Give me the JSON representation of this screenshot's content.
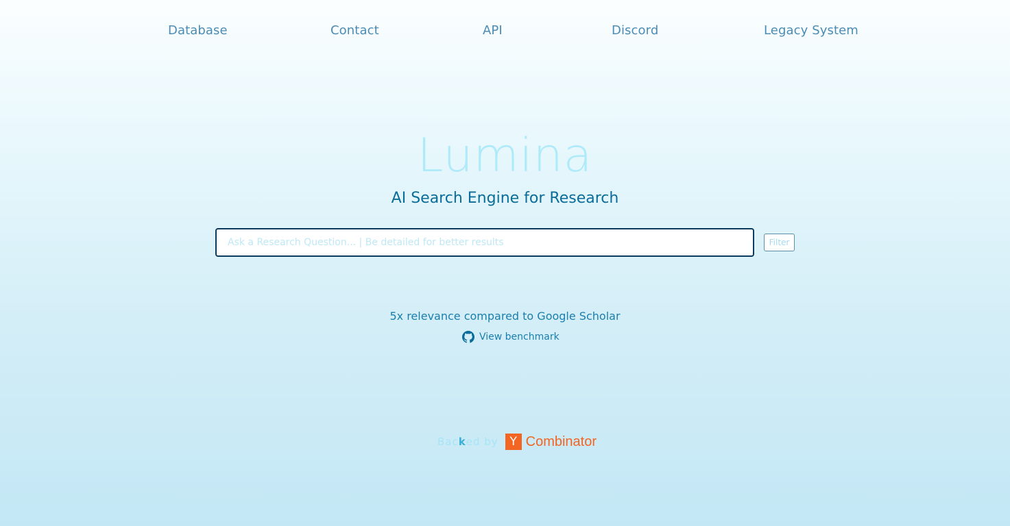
{
  "nav": {
    "items": [
      {
        "label": "Database"
      },
      {
        "label": "Contact"
      },
      {
        "label": "API"
      },
      {
        "label": "Discord"
      },
      {
        "label": "Legacy System"
      }
    ]
  },
  "hero": {
    "logo": "Lumina",
    "tagline": "AI Search Engine for Research"
  },
  "search": {
    "value": "",
    "placeholder": "Ask a Research Question... | Be detailed for better results",
    "filter_label": "Filter"
  },
  "benchmark": {
    "relevance_text": "5x relevance compared to Google Scholar",
    "link_label": "View benchmark",
    "icon": "github-icon"
  },
  "backing": {
    "prefix_pre": "Bac",
    "prefix_bold": "k",
    "prefix_post": "ed by",
    "yc_letter": "Y",
    "yc_name": "Combinator"
  },
  "colors": {
    "accent": "#0a6c98",
    "logo": "#aeeaf9",
    "yc_orange": "#f26522",
    "nav": "#4a8cb5"
  }
}
